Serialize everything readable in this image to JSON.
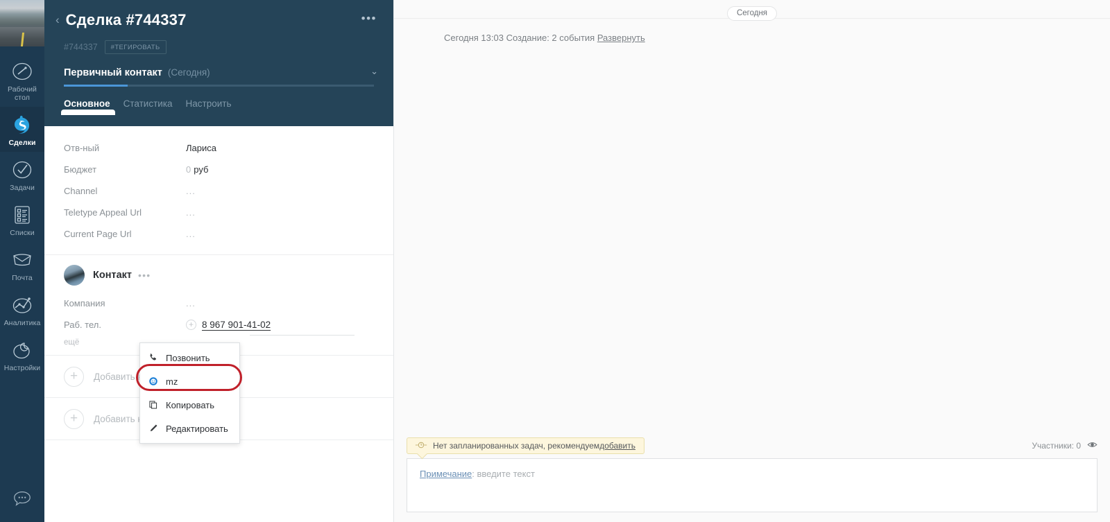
{
  "sidebar": {
    "photo_name": "user-cover-photo",
    "items": [
      {
        "label": "Рабочий стол",
        "icon": "dashboard-icon",
        "name": "sidebar-item-dashboard",
        "active": false
      },
      {
        "label": "Сделки",
        "icon": "deals-icon",
        "name": "sidebar-item-deals",
        "active": true
      },
      {
        "label": "Задачи",
        "icon": "tasks-icon",
        "name": "sidebar-item-tasks",
        "active": false
      },
      {
        "label": "Списки",
        "icon": "lists-icon",
        "name": "sidebar-item-lists",
        "active": false
      },
      {
        "label": "Почта",
        "icon": "mail-icon",
        "name": "sidebar-item-mail",
        "active": false
      },
      {
        "label": "Аналитика",
        "icon": "analytics-icon",
        "name": "sidebar-item-analytics",
        "active": false
      },
      {
        "label": "Настройки",
        "icon": "settings-icon",
        "name": "sidebar-item-settings",
        "active": false
      }
    ],
    "bottom_icon": "chat-bubble-icon"
  },
  "card": {
    "back_chevron": "‹",
    "title": "Сделка #744337",
    "menu_dots": "•••",
    "id_label": "#744337",
    "tag_button": "#ТЕГИРОВАТЬ",
    "stage_name": "Первичный контакт",
    "stage_date": "(Сегодня)",
    "stage_chevron": "⌄",
    "tabs": [
      {
        "label": "Основное",
        "active": true
      },
      {
        "label": "Статистика",
        "active": false
      },
      {
        "label": "Настроить",
        "active": false
      }
    ],
    "fields": [
      {
        "key": "Отв-ный",
        "value": "Лариса",
        "muted": false,
        "prefix": ""
      },
      {
        "key": "Бюджет",
        "value": "руб",
        "muted": false,
        "prefix": "0"
      },
      {
        "key": "Channel",
        "value": "...",
        "muted": true,
        "prefix": ""
      },
      {
        "key": "Teletype Appeal Url",
        "value": "...",
        "muted": true,
        "prefix": ""
      },
      {
        "key": "Current Page Url",
        "value": "...",
        "muted": true,
        "prefix": ""
      }
    ],
    "contact": {
      "avatar": "contact-avatar",
      "name": "Контакт",
      "dots": "•••",
      "company_key": "Компания",
      "company_value": "...",
      "phone_key": "Раб. тел.",
      "phone_value": "8 967 901-41-02",
      "more_label": "ещё"
    },
    "add_rows": [
      {
        "label": "Добавить контакт",
        "name": "add-contact-button"
      },
      {
        "label": "Добавить компанию",
        "name": "add-company-button"
      }
    ]
  },
  "context_menu": {
    "items": [
      {
        "label": "Позвонить",
        "icon": "phone-icon",
        "name": "context-menu-item-call",
        "highlighted": false
      },
      {
        "label": "mz",
        "icon": "mz-circle-icon",
        "name": "context-menu-item-mz",
        "highlighted": true
      },
      {
        "label": "Копировать",
        "icon": "copy-icon",
        "name": "context-menu-item-copy",
        "highlighted": false
      },
      {
        "label": "Редактировать",
        "icon": "pencil-icon",
        "name": "context-menu-item-edit",
        "highlighted": false
      }
    ],
    "highlight_color": "#c0202a"
  },
  "feed": {
    "day_pill": "Сегодня",
    "event_text": "Сегодня 13:03 Создание: 2 события ",
    "event_link": "Развернуть",
    "notice_text": "Нет запланированных задач, рекомендуем ",
    "notice_link": "добавить",
    "notice_icon": "clock-icon",
    "participants_label": "Участники: 0",
    "participants_icon": "eye-icon",
    "note_label": "Примечание",
    "note_placeholder": ": введите текст"
  }
}
